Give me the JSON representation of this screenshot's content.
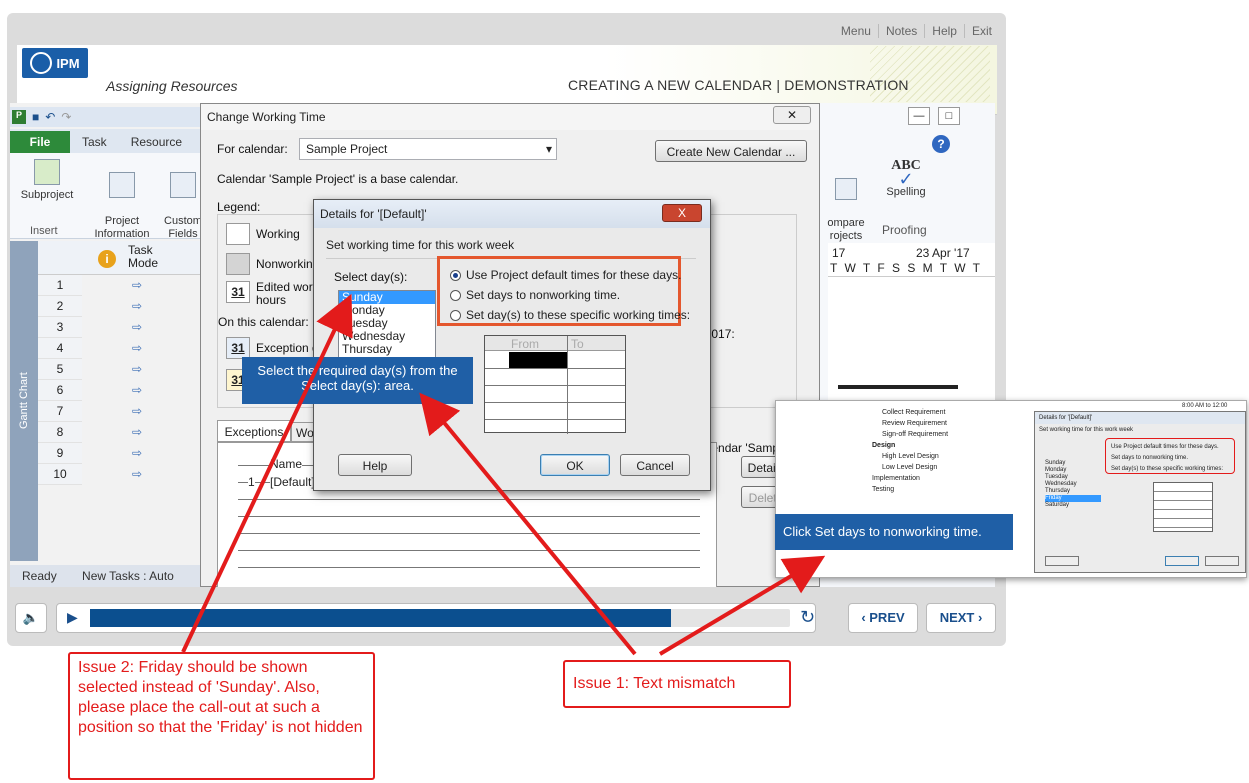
{
  "menu": [
    "Menu",
    "Notes",
    "Help",
    "Exit"
  ],
  "header": {
    "logo_text": "IPM",
    "lesson": "Assigning Resources",
    "slide_title": "CREATING A NEW CALENDAR | DEMONSTRATION"
  },
  "project": {
    "tabs": [
      "File",
      "Task",
      "Resource"
    ],
    "ribbon": {
      "subproject": "Subproject",
      "insert": "Insert",
      "project_info": "Project\nInformation",
      "custom_fields": "Custom\nFields",
      "compare": "ompare\nrojects",
      "spelling": "Spelling",
      "proofing": "Proofing"
    },
    "grid_header": "Task\nMode",
    "side_label": "Gantt Chart",
    "rows": [
      "1",
      "2",
      "3",
      "4",
      "5",
      "6",
      "7",
      "8",
      "9",
      "10"
    ],
    "status": "Ready",
    "status_new": "New Tasks : Auto",
    "timeline": [
      "17",
      "23 Apr '17"
    ],
    "days": "T W T F S S M T W T"
  },
  "cwt": {
    "title": "Change Working Time",
    "for_calendar": "For calendar:",
    "calendar_value": "Sample Project",
    "create_btn": "Create New Calendar ...",
    "base_note": "Calendar 'Sample Project' is a base calendar.",
    "legend": "Legend:",
    "working": "Working",
    "nonworking": "Nonworking",
    "edited": "Edited work\nhours",
    "on_this": "On this calendar:",
    "exception": "Exception d",
    "tab_exceptions": "Exceptions",
    "tab_work": "Work",
    "april": "il 2017:",
    "sample_calendar": "calendar 'Sample",
    "col_name": "Name",
    "row1_num": "1",
    "row1_name": "[Default]",
    "details_btn": "Details",
    "delete_btn": "Delete"
  },
  "details": {
    "title": "Details for '[Default]'",
    "close": "X",
    "heading": "Set working time for this work week",
    "select_days": "Select day(s):",
    "days": [
      "Sunday",
      "Monday",
      "Tuesday",
      "Wednesday",
      "Thursday"
    ],
    "selected_day": "Sunday",
    "options": [
      "Use Project default times for these days.",
      "Set days to nonworking time.",
      "Set day(s) to these specific working times:"
    ],
    "selected_option": 0,
    "from": "From",
    "to": "To",
    "help": "Help",
    "ok": "OK",
    "cancel": "Cancel"
  },
  "callout_main": "Select the required day(s) from the Select day(s): area.",
  "thumb": {
    "tasks": [
      "Collect Requirement",
      "Review Requirement",
      "Sign-off Requirement",
      "Design",
      "High Level Design",
      "Low Level Design",
      "Implementation",
      "Testing"
    ],
    "title": "Details for '[Default]'",
    "heading": "Set working time for this work week",
    "days": [
      "Sunday",
      "Monday",
      "Tuesday",
      "Wednesday",
      "Thursday",
      "Friday",
      "Saturday"
    ],
    "selected_day": "Friday",
    "options": [
      "Use Project default times for these days.",
      "Set days to nonworking time.",
      "Set day(s) to these specific working times:"
    ],
    "time": "8:00 AM to 12:00",
    "callout": "Click Set days to nonworking time."
  },
  "player": {
    "prev": "PREV",
    "next": "NEXT",
    "progress": 0.83
  },
  "issues": {
    "issue1": "Issue 1: Text mismatch",
    "issue2": "Issue 2: Friday should be shown selected instead of 'Sunday'. Also, please place the call-out at such a position so that the 'Friday' is not hidden"
  },
  "colors": {
    "brand": "#1a5ea8",
    "callout": "#1f5fa6",
    "annotation": "#e31b1b",
    "highlight": "#e4572e",
    "selection": "#3399ff"
  }
}
